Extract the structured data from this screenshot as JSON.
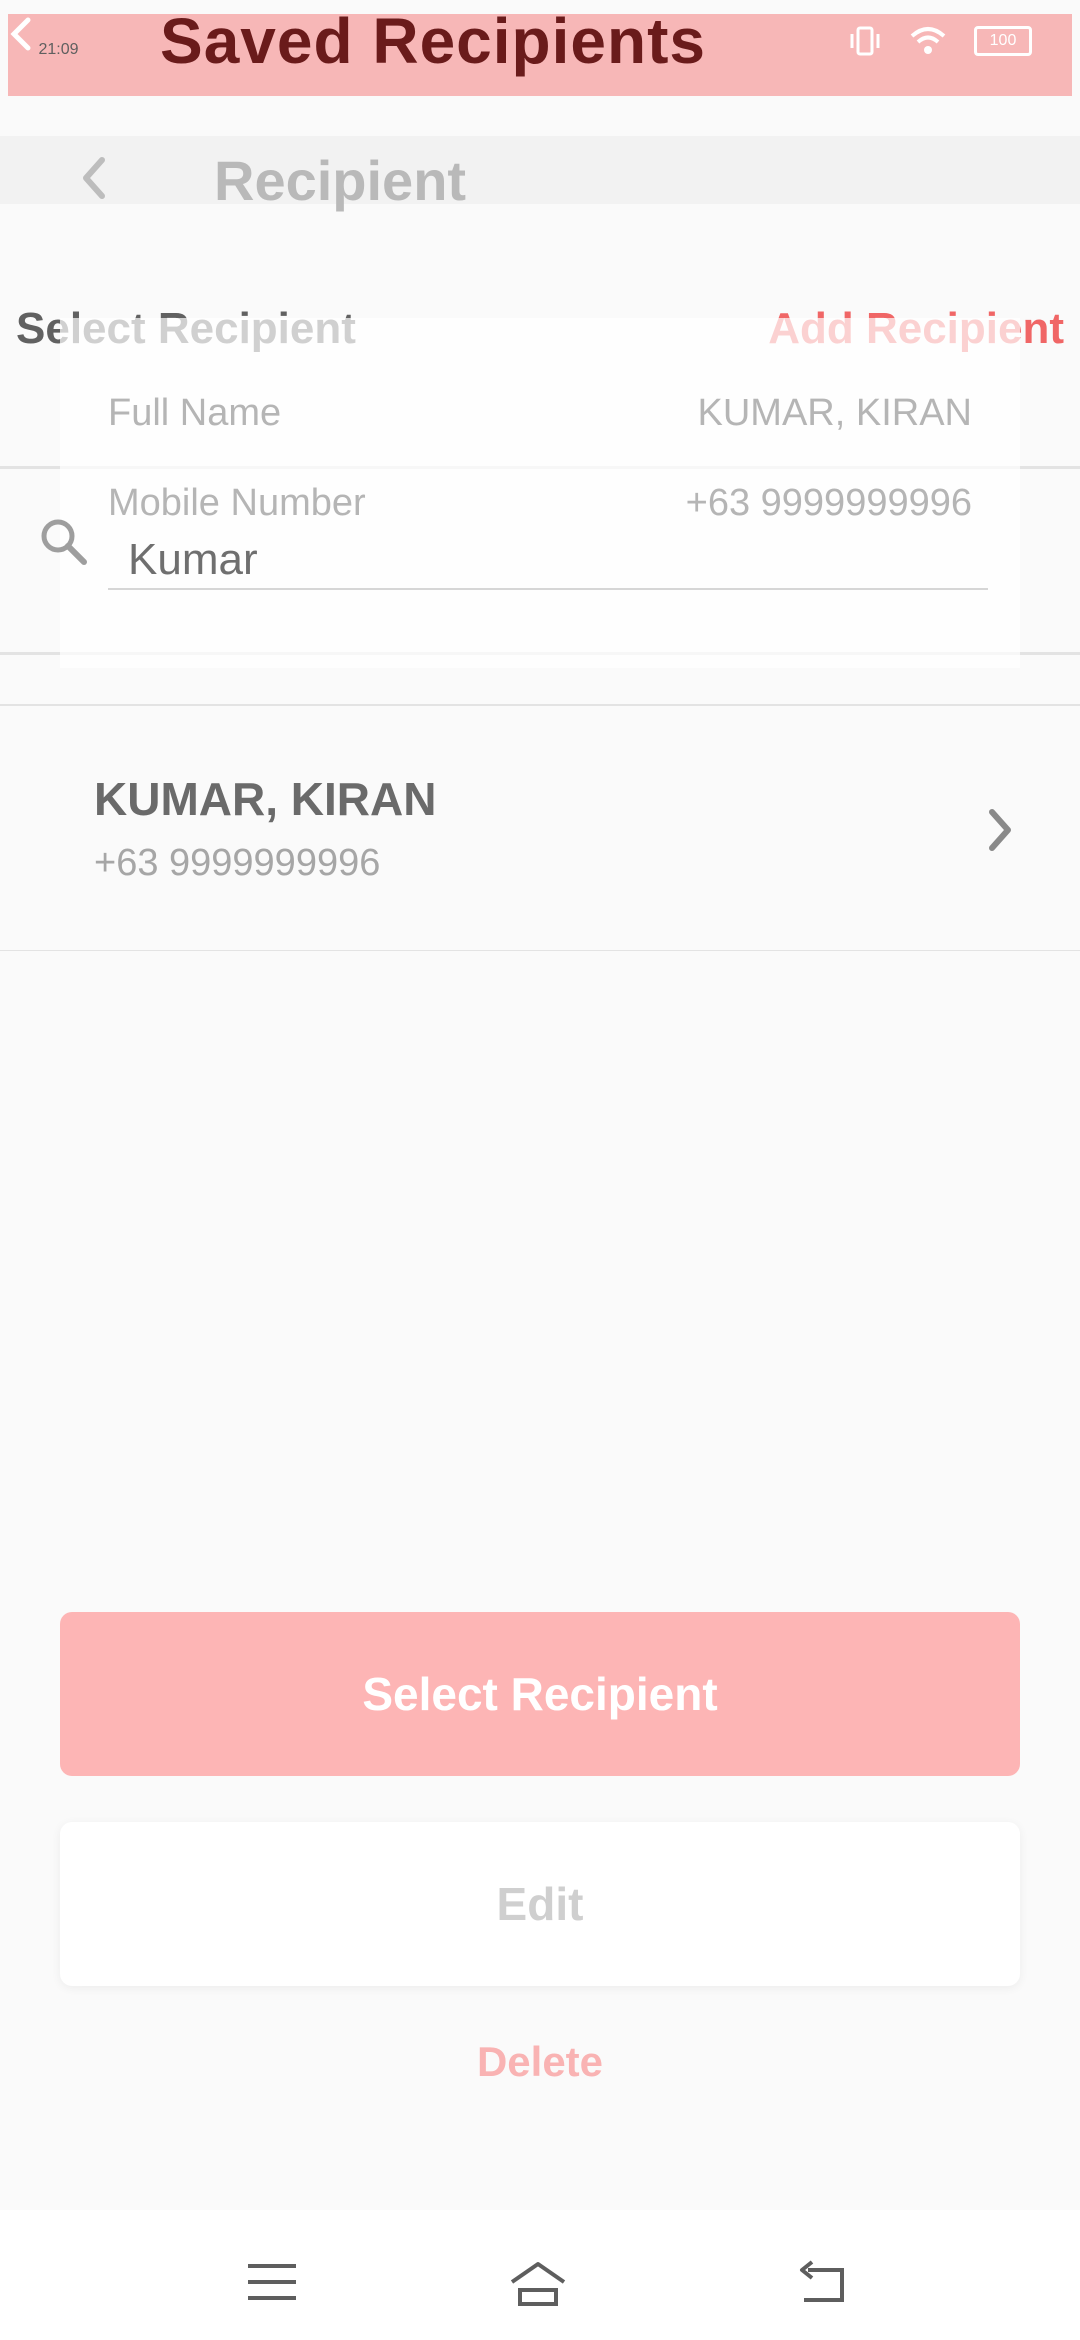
{
  "status_bar": {
    "time": "21:09",
    "battery": "100"
  },
  "overlay": {
    "title": "Saved Recipients"
  },
  "header": {
    "title": "Recipient"
  },
  "section": {
    "title": "Select Recipient",
    "add_link": "Add Recipient"
  },
  "details": {
    "full_name_label": "Full Name",
    "full_name_value": "KUMAR, KIRAN",
    "mobile_label": "Mobile Number",
    "mobile_value": "+63 9999999996"
  },
  "search": {
    "value": "Kumar"
  },
  "recipients": [
    {
      "name": "KUMAR, KIRAN",
      "phone": "+63 9999999996"
    }
  ],
  "actions": {
    "select": "Select Recipient",
    "edit": "Edit",
    "delete": "Delete"
  },
  "colors": {
    "accent": "#f06666",
    "primary_button": "#fdb5b5"
  },
  "icons": [
    "back-icon",
    "search-icon",
    "chevron-right-icon",
    "menu-icon",
    "home-icon",
    "back-nav-icon"
  ]
}
